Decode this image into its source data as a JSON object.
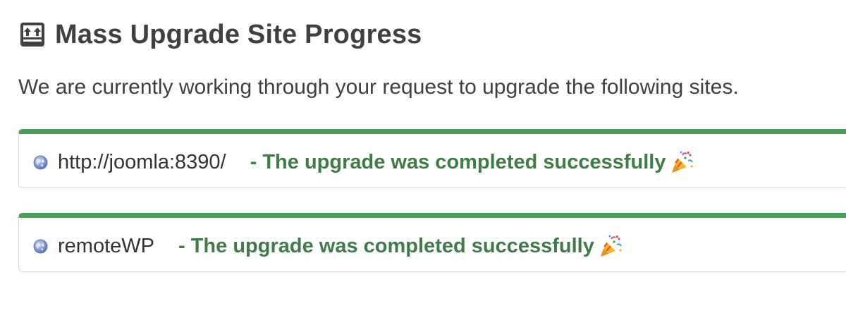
{
  "header": {
    "title": "Mass Upgrade Site Progress",
    "icon": "upload-box-icon"
  },
  "lead": "We are currently working through your request to upgrade the following sites.",
  "sites": [
    {
      "name": "http://joomla:8390/",
      "status": "- The upgrade was completed successfully",
      "icon": "globe-icon",
      "status_icon": "party-popper-icon"
    },
    {
      "name": "remoteWP",
      "status": "- The upgrade was completed successfully",
      "icon": "globe-icon",
      "status_icon": "party-popper-icon"
    }
  ],
  "colors": {
    "success_border": "#4a9e5a",
    "success_text": "#3f7d46",
    "title_text": "#404040"
  }
}
